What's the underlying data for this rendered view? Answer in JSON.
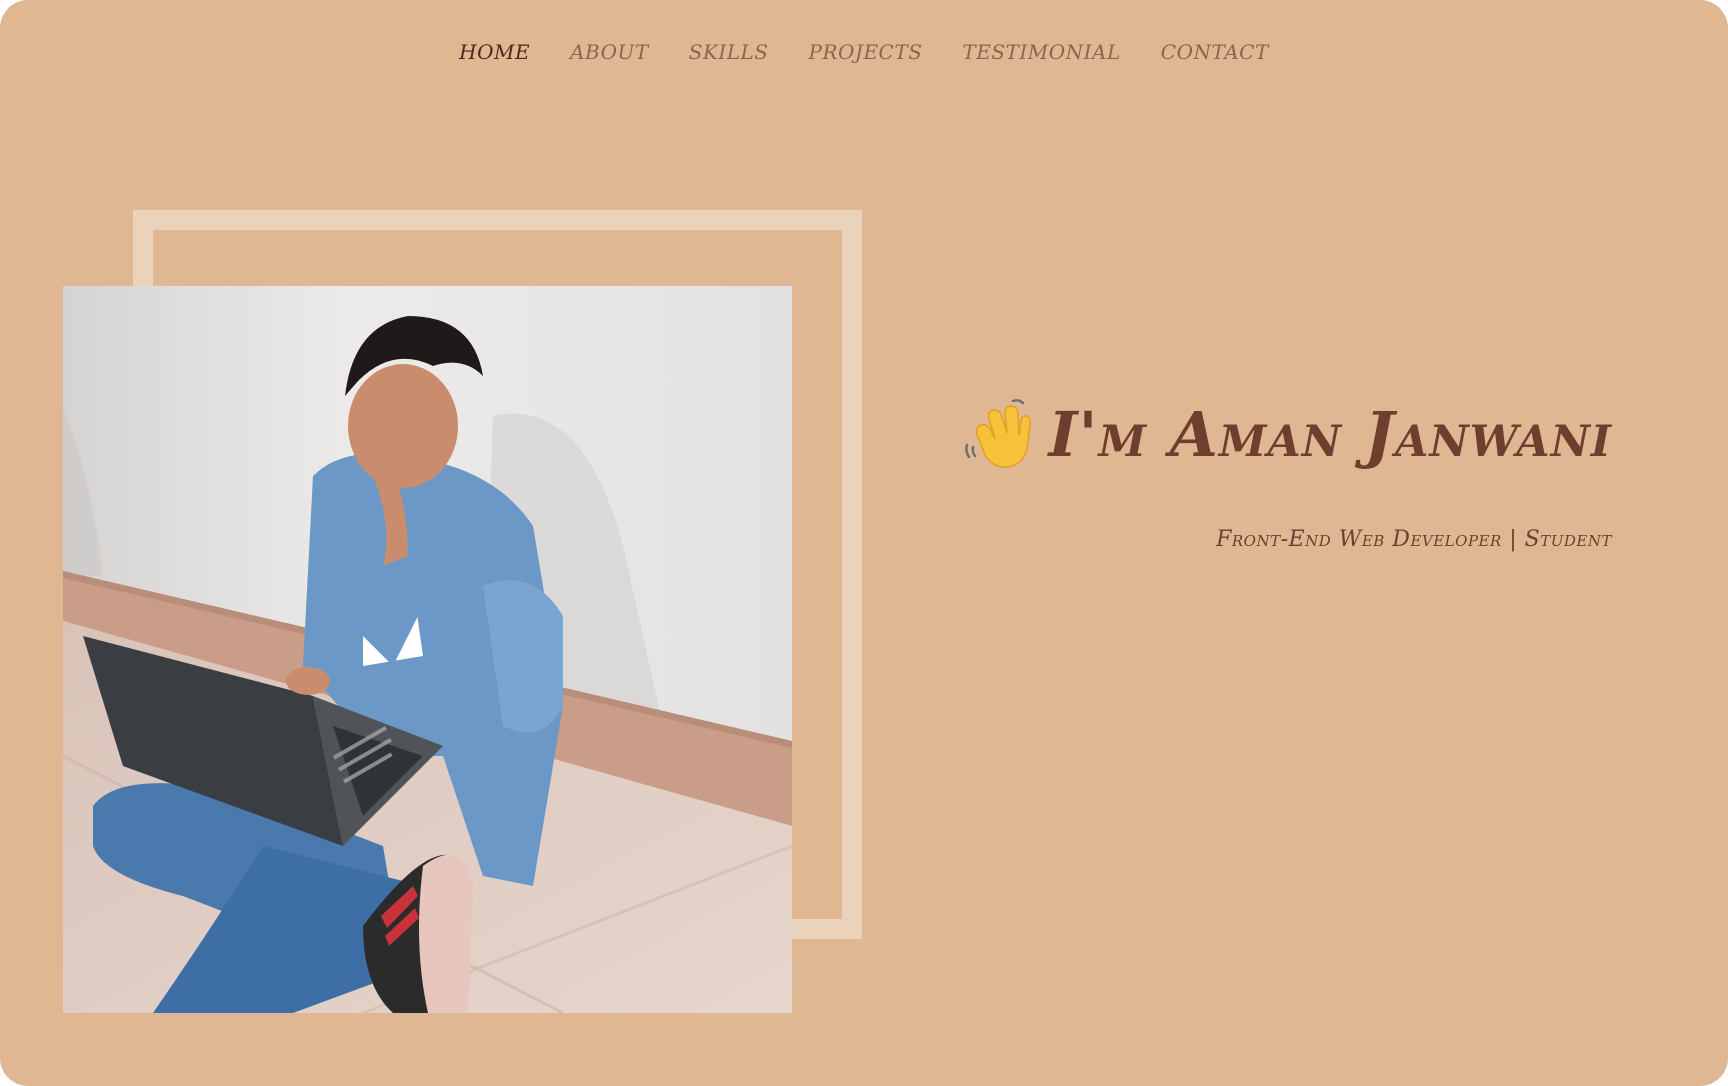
{
  "nav": {
    "items": [
      {
        "label": "Home",
        "active": true
      },
      {
        "label": "About",
        "active": false
      },
      {
        "label": "Skills",
        "active": false
      },
      {
        "label": "Projects",
        "active": false
      },
      {
        "label": "Testimonial",
        "active": false
      },
      {
        "label": "Contact",
        "active": false
      }
    ]
  },
  "hero": {
    "greeting_icon": "waving-hand-icon",
    "title": "I'm Aman Janwani",
    "subtitle": "Front-End Web Developer | Student"
  },
  "colors": {
    "background": "#dfb893",
    "frame": "#ebd3bb",
    "text_primary": "#6e3f2e",
    "nav_text": "#8a6651",
    "nav_active": "#4a2a1a"
  }
}
